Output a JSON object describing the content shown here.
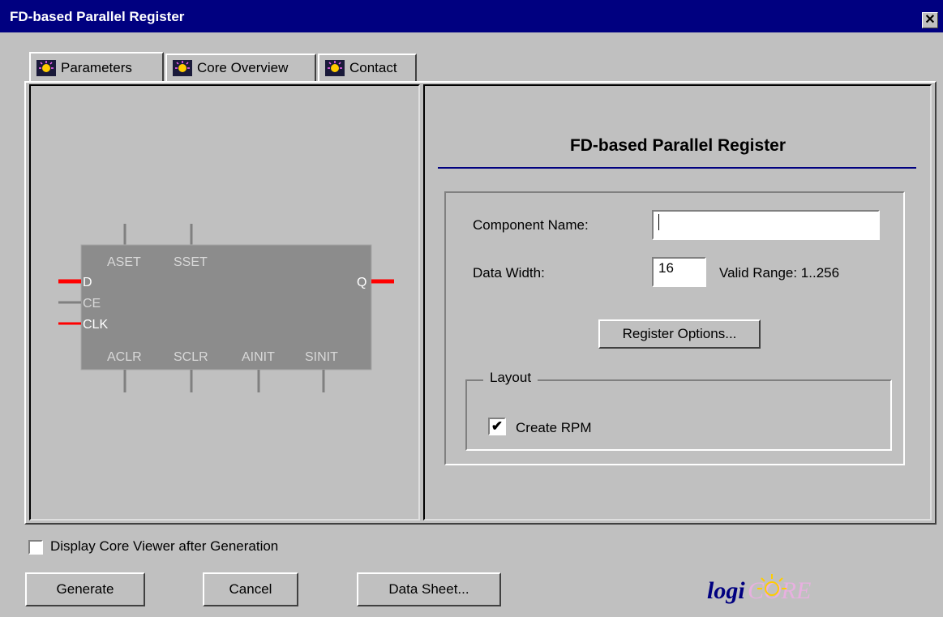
{
  "window": {
    "title": "FD-based Parallel Register",
    "close_glyph": "✕"
  },
  "tabs": [
    {
      "label": "Parameters",
      "icon": "logicore-bulb-icon",
      "active": true
    },
    {
      "label": "Core Overview",
      "icon": "logicore-bulb-icon",
      "active": false
    },
    {
      "label": "Contact",
      "icon": "logicore-bulb-icon",
      "active": false
    }
  ],
  "symbol": {
    "top_pins": [
      "ASET",
      "SSET"
    ],
    "left_pins": [
      "D",
      "CE",
      "CLK"
    ],
    "right_pins": [
      "Q"
    ],
    "bottom_pins": [
      "ACLR",
      "SCLR",
      "AINIT",
      "SINIT"
    ]
  },
  "form": {
    "heading": "FD-based Parallel Register",
    "component_name_label": "Component Name:",
    "component_name_value": "",
    "data_width_label": "Data Width:",
    "data_width_value": "16",
    "valid_range": "Valid Range: 1..256",
    "register_options_label": "Register Options...",
    "layout_legend": "Layout",
    "create_rpm_label": "Create RPM",
    "create_rpm_checked": true
  },
  "footer": {
    "display_viewer_label": "Display Core Viewer after Generation",
    "display_viewer_checked": false,
    "generate_label": "Generate",
    "cancel_label": "Cancel",
    "datasheet_label": "Data Sheet...",
    "logo_text_left": "logi",
    "logo_text_right": "CORE"
  },
  "colors": {
    "title_bg": "#000080",
    "accent_rule": "#000080",
    "pin_red": "#ff0000",
    "symbol_body": "#8c8c8c"
  }
}
